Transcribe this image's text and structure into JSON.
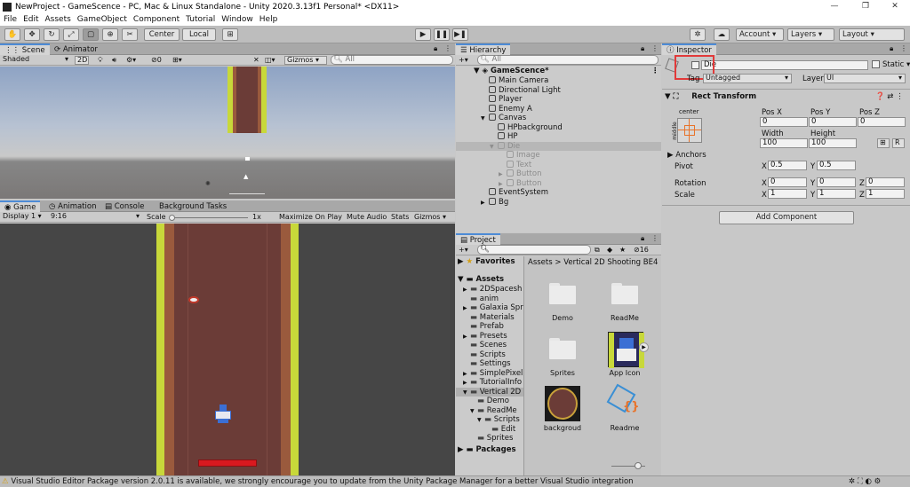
{
  "window": {
    "title": "NewProject - GameScence - PC, Mac & Linux Standalone - Unity 2020.3.13f1 Personal* <DX11>",
    "minimize": "—",
    "maximize": "❐",
    "close": "✕"
  },
  "menu": [
    "File",
    "Edit",
    "Assets",
    "GameObject",
    "Component",
    "Tutorial",
    "Window",
    "Help"
  ],
  "toolbar": {
    "center": "Center",
    "local": "Local",
    "account": "Account",
    "layers": "Layers",
    "layout": "Layout"
  },
  "scene_tabs": {
    "scene": "Scene",
    "animator": "Animator"
  },
  "scene_bar": {
    "shading": "Shaded",
    "mode2d": "2D",
    "hidden": "0",
    "gizmos": "Gizmos",
    "search": "All"
  },
  "game_tabs": {
    "game": "Game",
    "animation": "Animation",
    "console": "Console",
    "background": "Background Tasks"
  },
  "game_bar": {
    "display": "Display 1",
    "aspect": "9:16",
    "scale_label": "Scale",
    "scale_value": "1x",
    "maximize": "Maximize On Play",
    "mute": "Mute Audio",
    "stats": "Stats",
    "gizmos": "Gizmos"
  },
  "hierarchy": {
    "title": "Hierarchy",
    "search": "All",
    "scene_name": "GameScence*",
    "items": [
      {
        "label": "Main Camera",
        "indent": 1,
        "dim": false,
        "arrow": ""
      },
      {
        "label": "Directional Light",
        "indent": 1,
        "dim": false,
        "arrow": ""
      },
      {
        "label": "Player",
        "indent": 1,
        "dim": false,
        "arrow": ""
      },
      {
        "label": "Enemy A",
        "indent": 1,
        "dim": false,
        "arrow": ""
      },
      {
        "label": "Canvas",
        "indent": 1,
        "dim": false,
        "arrow": "▼"
      },
      {
        "label": "HPbackground",
        "indent": 2,
        "dim": false,
        "arrow": ""
      },
      {
        "label": "HP",
        "indent": 2,
        "dim": false,
        "arrow": ""
      },
      {
        "label": "Die",
        "indent": 2,
        "dim": true,
        "arrow": "▼",
        "selected": true
      },
      {
        "label": "Image",
        "indent": 3,
        "dim": true,
        "arrow": ""
      },
      {
        "label": "Text",
        "indent": 3,
        "dim": true,
        "arrow": ""
      },
      {
        "label": "Button",
        "indent": 3,
        "dim": true,
        "arrow": "▶"
      },
      {
        "label": "Button",
        "indent": 3,
        "dim": true,
        "arrow": "▶"
      },
      {
        "label": "EventSystem",
        "indent": 1,
        "dim": false,
        "arrow": ""
      },
      {
        "label": "Bg",
        "indent": 1,
        "dim": false,
        "arrow": "▶"
      }
    ]
  },
  "project": {
    "title": "Project",
    "hidden_count": "16",
    "favorites": "Favorites",
    "assets_root": "Assets",
    "packages": "Packages",
    "breadcrumb_root": "Assets",
    "breadcrumb_sep": ">",
    "breadcrumb_current": "Vertical 2D Shooting BE4",
    "tree": [
      {
        "label": "2DSpacesh",
        "indent": 1,
        "arrow": "▶"
      },
      {
        "label": "anim",
        "indent": 1,
        "arrow": ""
      },
      {
        "label": "Galaxia Spr",
        "indent": 1,
        "arrow": "▶"
      },
      {
        "label": "Materials",
        "indent": 1,
        "arrow": ""
      },
      {
        "label": "Prefab",
        "indent": 1,
        "arrow": ""
      },
      {
        "label": "Presets",
        "indent": 1,
        "arrow": "▶"
      },
      {
        "label": "Scenes",
        "indent": 1,
        "arrow": ""
      },
      {
        "label": "Scripts",
        "indent": 1,
        "arrow": ""
      },
      {
        "label": "Settings",
        "indent": 1,
        "arrow": ""
      },
      {
        "label": "SimplePixel",
        "indent": 1,
        "arrow": "▶"
      },
      {
        "label": "TutorialInfo",
        "indent": 1,
        "arrow": "▶"
      },
      {
        "label": "Vertical 2D",
        "indent": 1,
        "arrow": "▼",
        "selected": true
      },
      {
        "label": "Demo",
        "indent": 2,
        "arrow": ""
      },
      {
        "label": "ReadMe",
        "indent": 2,
        "arrow": "▼"
      },
      {
        "label": "Scripts",
        "indent": 3,
        "arrow": "▼"
      },
      {
        "label": "Edit",
        "indent": 4,
        "arrow": ""
      },
      {
        "label": "Sprites",
        "indent": 2,
        "arrow": ""
      }
    ],
    "grid": [
      "Demo",
      "ReadMe",
      "Sprites",
      "App Icon",
      "backgroud",
      "Readme"
    ]
  },
  "inspector": {
    "title": "Inspector",
    "name": "Die",
    "static_label": "Static",
    "tag_label": "Tag",
    "tag_value": "Untagged",
    "layer_label": "Layer",
    "layer_value": "UI",
    "component": "Rect Transform",
    "anchor_preset": "center",
    "anchor_side": "middle",
    "pos_x_label": "Pos X",
    "pos_y_label": "Pos Y",
    "pos_z_label": "Pos Z",
    "pos_x": "0",
    "pos_y": "0",
    "pos_z": "0",
    "width_label": "Width",
    "height_label": "Height",
    "width": "100",
    "height": "100",
    "anchors_label": "Anchors",
    "pivot_label": "Pivot",
    "pivot_x": "0.5",
    "pivot_y": "0.5",
    "rotation_label": "Rotation",
    "rot_x": "0",
    "rot_y": "0",
    "rot_z": "0",
    "scale_label": "Scale",
    "scale_x": "1",
    "scale_y": "1",
    "scale_z": "1",
    "x": "X",
    "y": "Y",
    "z": "Z",
    "raw_btn": "R",
    "add_component": "Add Component"
  },
  "status": {
    "message": "Visual Studio Editor Package version 2.0.11 is available, we strongly encourage you to update from the Unity Package Manager for a better Visual Studio integration"
  },
  "colors": {
    "selection": "#4d8bd6",
    "highlight_box": "#e23a3a",
    "hp_bar": "#d8191f",
    "road": "#6b3c37",
    "grass": "#c8d83a"
  }
}
